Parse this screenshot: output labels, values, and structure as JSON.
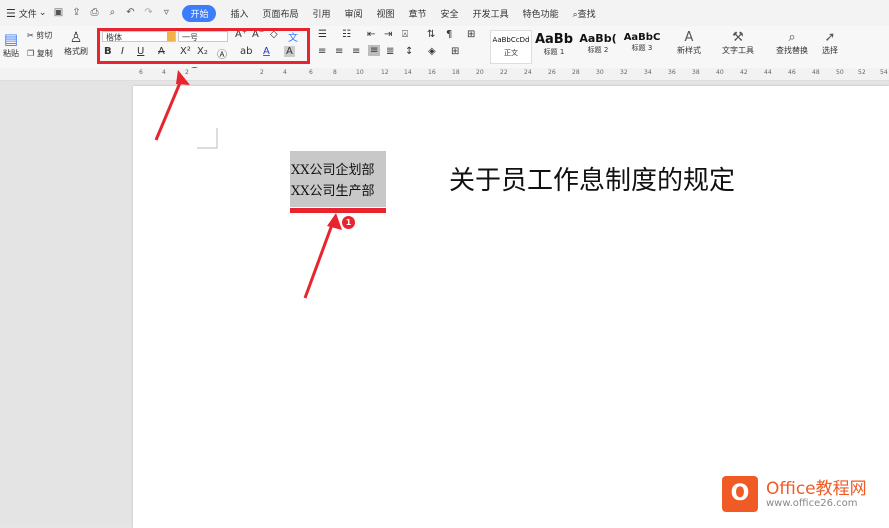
{
  "menubar": {
    "file_label": "文件",
    "tabs": [
      "开始",
      "插入",
      "页面布局",
      "引用",
      "审阅",
      "视图",
      "章节",
      "安全",
      "开发工具",
      "特色功能"
    ],
    "active_tab": "开始",
    "search_label": "查找"
  },
  "ribbon": {
    "paste_label": "粘贴",
    "cut_label": "剪切",
    "copy_label": "复制",
    "format_painter_label": "格式刷",
    "font_name": "楷体",
    "font_size": "一号",
    "styles": [
      {
        "preview": "AaBbCcDd",
        "label": "正文"
      },
      {
        "preview": "AaBb",
        "label": "标题 1"
      },
      {
        "preview": "AaBb(",
        "label": "标题 2"
      },
      {
        "preview": "AaBbC",
        "label": "标题 3"
      }
    ],
    "new_style_label": "新样式",
    "text_tools_label": "文字工具",
    "find_replace_label": "查找替换",
    "select_label": "选择"
  },
  "ruler_ticks": [
    "6",
    "4",
    "2",
    "2",
    "4",
    "6",
    "8",
    "10",
    "12",
    "14",
    "16",
    "18",
    "20",
    "22",
    "24",
    "26",
    "28",
    "30",
    "32",
    "34",
    "36",
    "38",
    "40",
    "42",
    "44",
    "46",
    "48",
    "50",
    "52",
    "54"
  ],
  "document": {
    "selected_lines": [
      "XX公司企划部",
      "XX公司生产部"
    ],
    "title": "关于员工作息制度的规定"
  },
  "annotations": {
    "badge_1": "1",
    "badge_2": "2"
  },
  "watermark": {
    "brand": "Office教程网",
    "url": "www.office26.com"
  }
}
